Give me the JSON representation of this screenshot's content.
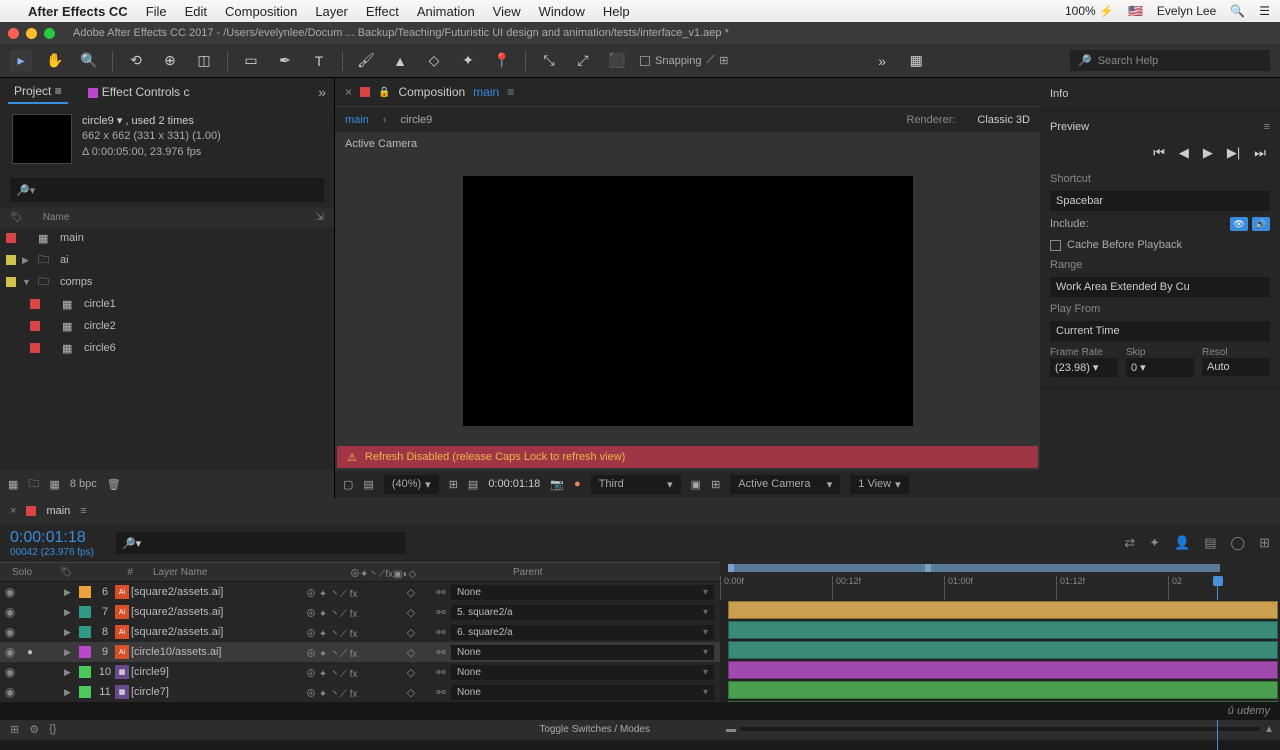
{
  "menubar": {
    "app": "After Effects CC",
    "items": [
      "File",
      "Edit",
      "Composition",
      "Layer",
      "Effect",
      "Animation",
      "View",
      "Window",
      "Help"
    ],
    "battery": "100%",
    "user": "Evelyn Lee"
  },
  "titlebar": "Adobe After Effects CC 2017 - /Users/evelynlee/Docum ... Backup/Teaching/Futuristic UI design and animation/tests/interface_v1.aep *",
  "toolbar": {
    "snapping": "Snapping",
    "help_ph": "Search Help"
  },
  "project": {
    "tab_project": "Project",
    "tab_effects": "Effect Controls c",
    "item_name": "circle9 ▾ , used 2 times",
    "item_dim": "662 x 662  (331 x 331)  (1.00)",
    "item_dur": "Δ 0:00:05:00, 23.976 fps",
    "col_name": "Name",
    "rows": [
      {
        "color": "#d94545",
        "arrow": "",
        "indent": 0,
        "icon": "▦",
        "name": "main"
      },
      {
        "color": "#d0c24a",
        "arrow": "▶",
        "indent": 0,
        "icon": "▢",
        "name": "ai"
      },
      {
        "color": "#d0c24a",
        "arrow": "▼",
        "indent": 0,
        "icon": "▢",
        "name": "comps"
      },
      {
        "color": "#d94545",
        "arrow": "",
        "indent": 1,
        "icon": "▦",
        "name": "circle1"
      },
      {
        "color": "#d94545",
        "arrow": "",
        "indent": 1,
        "icon": "▦",
        "name": "circle2"
      },
      {
        "color": "#d94545",
        "arrow": "",
        "indent": 1,
        "icon": "▦",
        "name": "circle6"
      }
    ],
    "bpc": "8 bpc"
  },
  "comp": {
    "label": "Composition",
    "name": "main",
    "crumb1": "main",
    "crumb2": "circle9",
    "renderer_lbl": "Renderer:",
    "renderer": "Classic 3D",
    "active_cam": "Active Camera",
    "warning": "Refresh Disabled (release Caps Lock to refresh view)",
    "footer": {
      "mag": "(40%)",
      "time": "0:00:01:18",
      "res": "Third",
      "cam": "Active Camera",
      "view": "1 View"
    }
  },
  "right": {
    "info": "Info",
    "preview": "Preview",
    "shortcut_lbl": "Shortcut",
    "shortcut": "Spacebar",
    "include": "Include:",
    "cache": "Cache Before Playback",
    "range_lbl": "Range",
    "range": "Work Area Extended By Cu",
    "playfrom_lbl": "Play From",
    "playfrom": "Current Time",
    "fr_lbl": "Frame Rate",
    "fr": "(23.98)",
    "skip_lbl": "Skip",
    "skip": "0",
    "res_lbl": "Resol",
    "res": "Auto"
  },
  "timeline": {
    "comp": "main",
    "time": "0:00:01:18",
    "frame": "00042 (23.976 fps)",
    "h_solo": "Solo",
    "h_num": "#",
    "h_name": "Layer Name",
    "h_parent": "Parent",
    "footer": "Toggle Switches / Modes",
    "ruler": [
      "0:00f",
      "00:12f",
      "01:00f",
      "01:12f",
      "02"
    ],
    "rows": [
      {
        "n": "6",
        "c": "#e8a23c",
        "t": "ai",
        "name": "[square2/assets.ai]",
        "p": "None",
        "bar": "#caa050"
      },
      {
        "n": "7",
        "c": "#2f9a88",
        "t": "ai",
        "name": "[square2/assets.ai]",
        "p": "5. square2/a",
        "bar": "#3a8a7a"
      },
      {
        "n": "8",
        "c": "#2f9a88",
        "t": "ai",
        "name": "[square2/assets.ai]",
        "p": "6. square2/a",
        "bar": "#3a8a7a"
      },
      {
        "n": "9",
        "c": "#b84aca",
        "t": "ai",
        "name": "[circle10/assets.ai]",
        "p": "None",
        "bar": "#a04ab0",
        "sel": true,
        "solo": true
      },
      {
        "n": "10",
        "c": "#4aca5a",
        "t": "cp",
        "name": "[circle9]",
        "p": "None",
        "bar": "#4aa050"
      },
      {
        "n": "11",
        "c": "#4aca5a",
        "t": "cp",
        "name": "[circle7]",
        "p": "None",
        "bar": "#4aa050"
      }
    ]
  }
}
